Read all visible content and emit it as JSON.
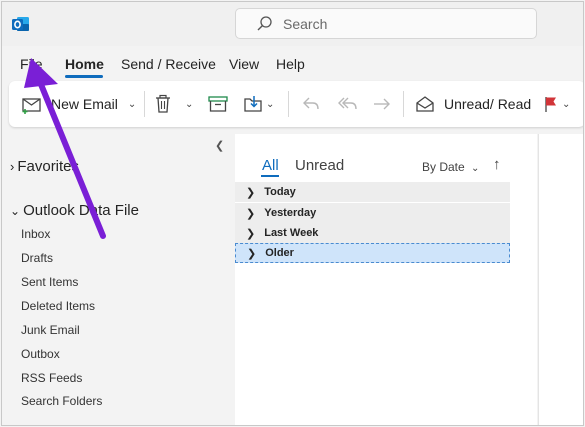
{
  "search": {
    "placeholder": "Search"
  },
  "menu": {
    "items": [
      {
        "label": "File"
      },
      {
        "label": "Home"
      },
      {
        "label": "Send / Receive"
      },
      {
        "label": "View"
      },
      {
        "label": "Help"
      }
    ],
    "active": "Home"
  },
  "ribbon": {
    "new_email": "New Email",
    "unread_read": "Unread/ Read"
  },
  "folders": {
    "favorites": "Favorites",
    "data_file": "Outlook Data File",
    "items": [
      "Inbox",
      "Drafts",
      "Sent Items",
      "Deleted Items",
      "Junk Email",
      "Outbox",
      "RSS Feeds",
      "Search Folders"
    ]
  },
  "mail_list": {
    "tab_all": "All",
    "tab_unread": "Unread",
    "sort_label": "By Date",
    "groups": [
      "Today",
      "Yesterday",
      "Last Week",
      "Older"
    ],
    "selected_group": "Older"
  },
  "colors": {
    "accent": "#0f6cbd",
    "annotation_arrow": "#7a1fd6",
    "flag": "#d13438",
    "selection": "#cfe4fa"
  }
}
